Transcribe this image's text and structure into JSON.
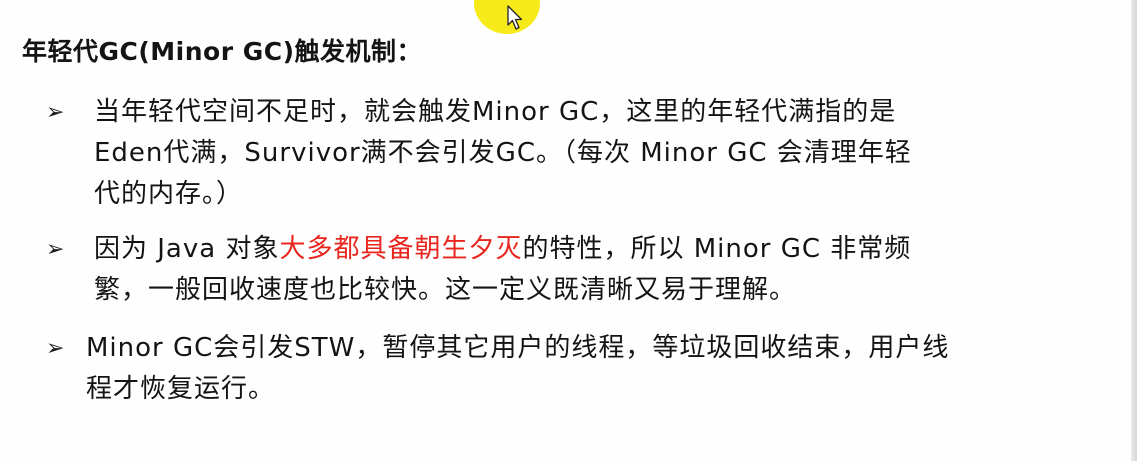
{
  "title": "年轻代GC(Minor GC)触发机制：",
  "bullet_marker": "➢",
  "accent_color": "#e8261e",
  "bullets": [
    {
      "lines": [
        "当年轻代空间不足时，就会触发Minor GC，这里的年轻代满指的是",
        "Eden代满，Survivor满不会引发GC。（每次 Minor GC 会清理年轻",
        "代的内存。）"
      ]
    },
    {
      "line1_before": "因为 Java 对象",
      "line1_highlight": "大多都具备朝生夕灭",
      "line1_after": "的特性，所以 Minor GC 非常频",
      "line2": "繁，一般回收速度也比较快。这一定义既清晰又易于理解。"
    },
    {
      "lines": [
        "Minor GC会引发STW，暂停其它用户的线程，等垃圾回收结束，用户线",
        "程才恢复运行。"
      ]
    }
  ],
  "cursor_icon": "mouse-pointer-icon"
}
